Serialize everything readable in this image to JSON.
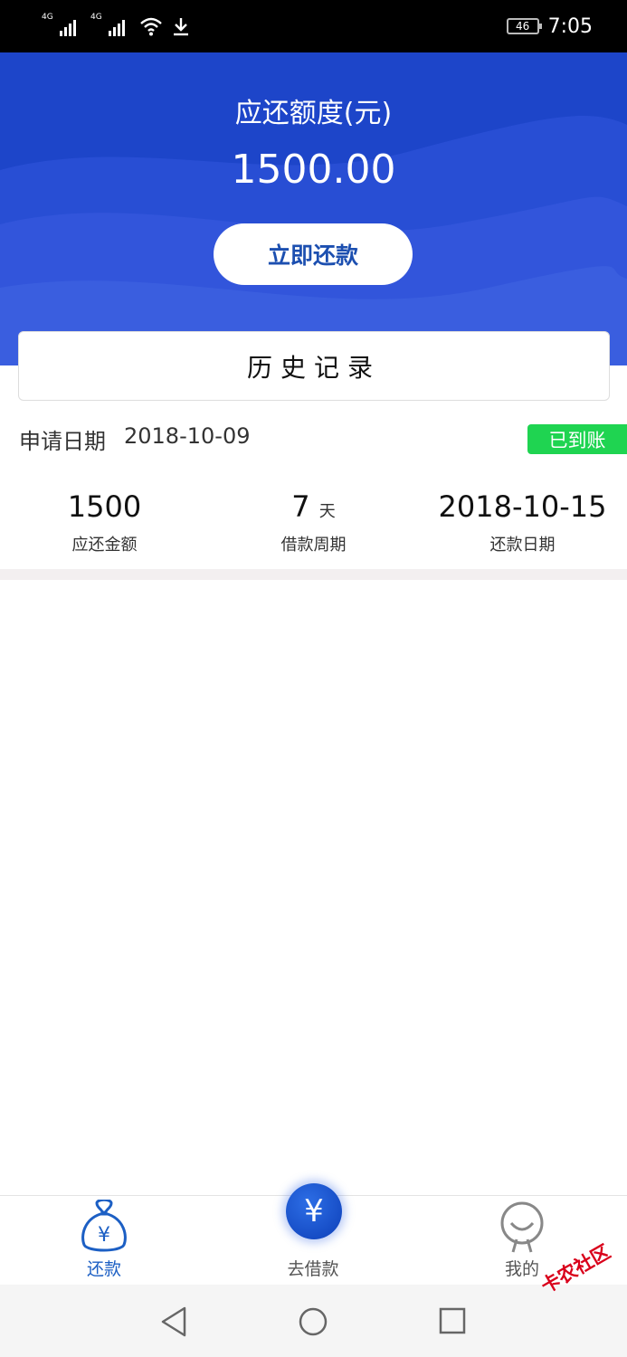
{
  "status_bar": {
    "sim1": "4G",
    "sim2": "4G",
    "battery": "46",
    "time": "7:05"
  },
  "header": {
    "title": "应还额度(元)",
    "amount": "1500.00",
    "repay_button": "立即还款"
  },
  "history": {
    "title": "历史记录"
  },
  "record": {
    "apply_label": "申请日期",
    "apply_date": "2018-10-09",
    "status": "已到账",
    "amount_value": "1500",
    "amount_label": "应还金额",
    "period_value": "7",
    "period_unit": "天",
    "period_label": "借款周期",
    "due_value": "2018-10-15",
    "due_label": "还款日期"
  },
  "tabbar": {
    "repay": "还款",
    "borrow_icon": "¥",
    "borrow": "去借款",
    "mine": "我的"
  },
  "watermark": "卡农社区",
  "colors": {
    "header_blue": "#1d45c9",
    "button_text": "#1c4fb0",
    "status_green": "#1fd451",
    "tab_active": "#1c5fc4"
  }
}
